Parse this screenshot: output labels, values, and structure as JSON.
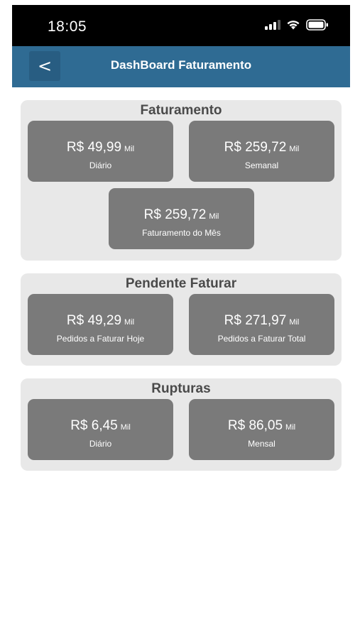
{
  "status_bar": {
    "time": "18:05",
    "icons": [
      "signal-icon",
      "wifi-icon",
      "battery-icon"
    ]
  },
  "header": {
    "back_label": "<",
    "title": "DashBoard Faturamento",
    "color": "#2f6b93"
  },
  "sections": [
    {
      "title": "Faturamento",
      "cards": [
        {
          "value": "R$ 49,99",
          "unit": "Mil",
          "label": "Diário"
        },
        {
          "value": "R$ 259,72",
          "unit": "Mil",
          "label": "Semanal"
        },
        {
          "value": "R$ 259,72",
          "unit": "Mil",
          "label": "Faturamento do Mês"
        }
      ]
    },
    {
      "title": "Pendente Faturar",
      "cards": [
        {
          "value": "R$ 49,29",
          "unit": "Mil",
          "label": "Pedidos a Faturar Hoje"
        },
        {
          "value": "R$ 271,97",
          "unit": "Mil",
          "label": "Pedidos a Faturar Total"
        }
      ]
    },
    {
      "title": "Rupturas",
      "cards": [
        {
          "value": "R$ 6,45",
          "unit": "Mil",
          "label": "Diário"
        },
        {
          "value": "R$ 86,05",
          "unit": "Mil",
          "label": "Mensal"
        }
      ]
    }
  ]
}
